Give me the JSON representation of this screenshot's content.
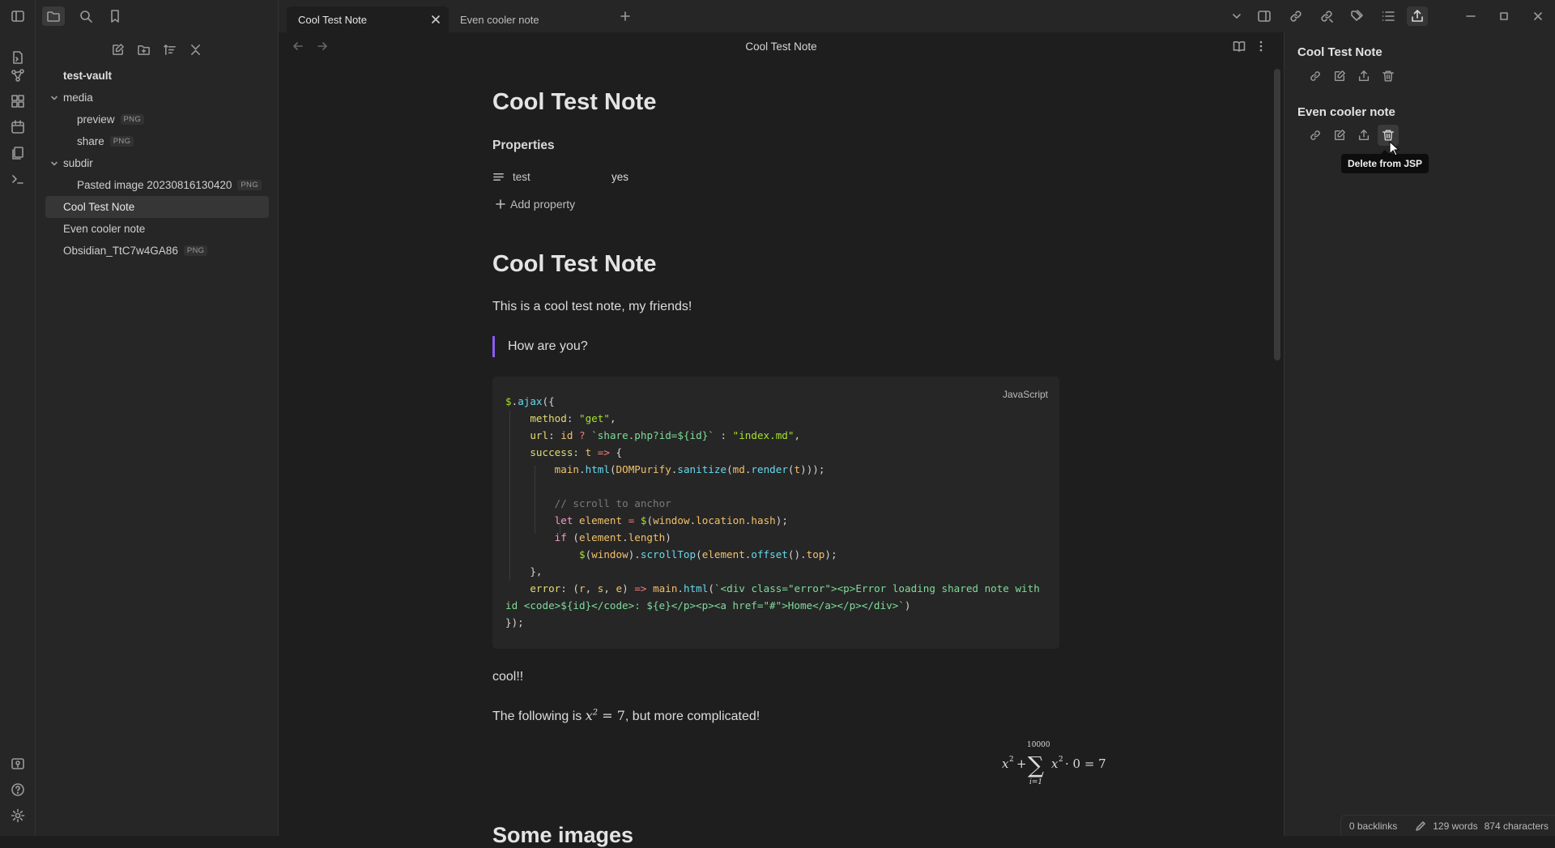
{
  "tabs": [
    {
      "label": "Cool Test Note",
      "active": true
    },
    {
      "label": "Even cooler note",
      "active": false
    }
  ],
  "file_tree": {
    "vault": "test-vault",
    "items": [
      {
        "label": "media",
        "type": "folder"
      },
      {
        "label": "preview",
        "tag": "PNG"
      },
      {
        "label": "share",
        "tag": "PNG"
      },
      {
        "label": "subdir",
        "type": "folder"
      },
      {
        "label": "Pasted image 20230816130420",
        "tag": "PNG"
      },
      {
        "label": "Cool Test Note",
        "selected": true
      },
      {
        "label": "Even cooler note"
      },
      {
        "label": "Obsidian_TtC7w4GA86",
        "tag": "PNG"
      }
    ]
  },
  "view": {
    "title": "Cool Test Note"
  },
  "note": {
    "inline_title": "Cool Test Note",
    "properties_heading": "Properties",
    "property": {
      "key": "test",
      "value": "yes"
    },
    "add_property": "Add property",
    "h1": "Cool Test Note",
    "intro": "This is a cool test note, my friends!",
    "quote": "How are you?",
    "code_lang": "JavaScript",
    "after_code": "cool!!",
    "math_prefix": "The following is ",
    "math_suffix": ", but more complicated!",
    "next_heading": "Some images"
  },
  "right_panel": {
    "notes": [
      {
        "title": "Cool Test Note"
      },
      {
        "title": "Even cooler note"
      }
    ],
    "tooltip": "Delete from JSP"
  },
  "status_bar": {
    "backlinks": "0 backlinks",
    "words": "129 words",
    "characters": "874 characters"
  },
  "colors": {
    "accent": "#8a5cf5",
    "background": "#1e1e1e",
    "sidebar": "#262626"
  }
}
